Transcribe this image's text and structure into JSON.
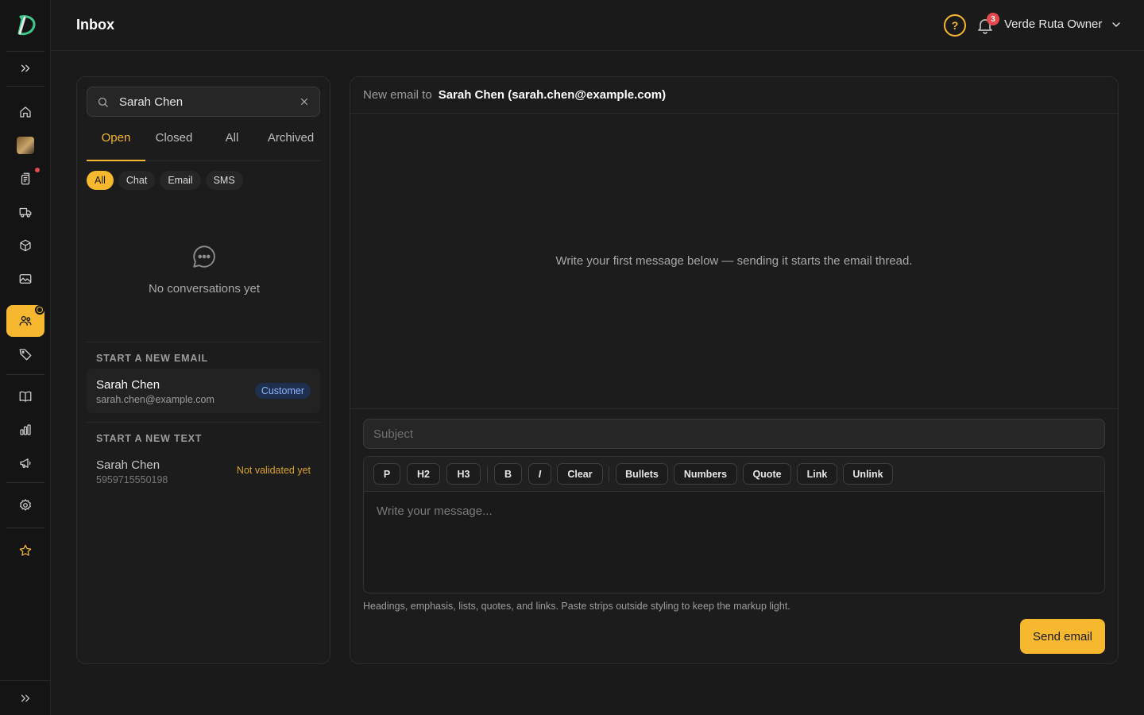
{
  "app": {
    "page_title": "Inbox",
    "accent_color": "#f5b82e"
  },
  "header": {
    "help_icon": "question-circle-icon",
    "notifications_count": "3",
    "user_name": "Verde Ruta Owner"
  },
  "sidebar": {
    "items": [
      {
        "name": "home-icon"
      },
      {
        "name": "avatar-photo"
      },
      {
        "name": "orders-icon",
        "has_alert_dot": true
      },
      {
        "name": "truck-icon"
      },
      {
        "name": "box-icon"
      },
      {
        "name": "image-icon"
      },
      {
        "name": "customers-icon",
        "active": true
      },
      {
        "name": "tag-icon"
      },
      {
        "name": "book-icon"
      },
      {
        "name": "bar-chart-icon"
      },
      {
        "name": "megaphone-icon"
      },
      {
        "name": "gear-icon"
      },
      {
        "name": "star-icon"
      }
    ]
  },
  "list": {
    "search_value": "Sarah Chen",
    "tabs": [
      "Open",
      "Closed",
      "All",
      "Archived"
    ],
    "active_tab": "Open",
    "filters": [
      "All",
      "Chat",
      "Email",
      "SMS"
    ],
    "active_filter": "All",
    "empty_text": "No conversations yet",
    "email_section_label": "START A NEW EMAIL",
    "email_contact": {
      "name": "Sarah Chen",
      "email": "sarah.chen@example.com",
      "badge": "Customer"
    },
    "text_section_label": "START A NEW TEXT",
    "text_contact": {
      "name": "Sarah Chen",
      "phone": "5959715550198",
      "status": "Not validated yet"
    }
  },
  "composer": {
    "to_label": "New email to",
    "to_value": "Sarah Chen (sarah.chen@example.com)",
    "thread_hint": "Write your first message below — sending it starts the email thread.",
    "subject_placeholder": "Subject",
    "toolbar": {
      "p": "P",
      "h2": "H2",
      "h3": "H3",
      "bold": "B",
      "italic": "I",
      "clear": "Clear",
      "bullets": "Bullets",
      "numbers": "Numbers",
      "quote": "Quote",
      "link": "Link",
      "unlink": "Unlink"
    },
    "message_placeholder": "Write your message...",
    "editor_hint": "Headings, emphasis, lists, quotes, and links. Paste strips outside styling to keep the markup light.",
    "send_label": "Send email"
  }
}
